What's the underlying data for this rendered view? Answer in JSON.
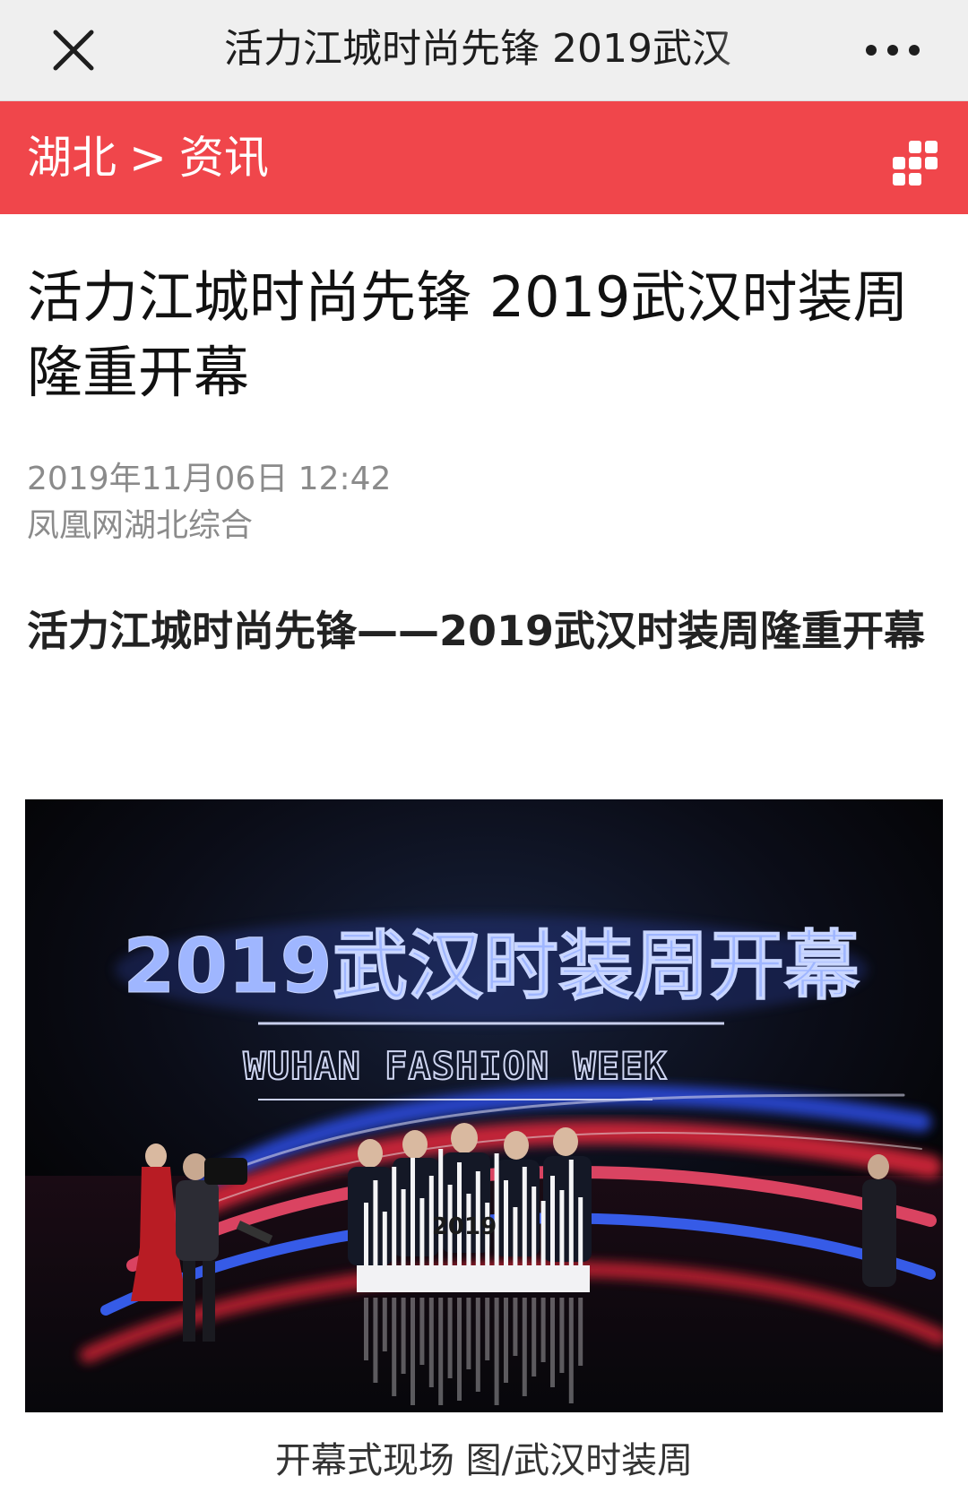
{
  "topbar": {
    "title": "活力江城时尚先锋 2019武汉",
    "close_icon": "close-icon",
    "more_icon": "more-icon"
  },
  "channel": {
    "crumbs": [
      "湖北",
      "资讯"
    ],
    "separator": ">",
    "menu_icon": "grid-menu-icon",
    "color": "#f0464b"
  },
  "article": {
    "title": "活力江城时尚先锋 2019武汉时装周隆重开幕",
    "date": "2019年11月06日 12:42",
    "source": "凤凰网湖北综合",
    "subtitle": "活力江城时尚先锋——2019武汉时装周隆重开幕"
  },
  "photo": {
    "headline": "2019武汉时装周开幕",
    "sub_headline": "WUHAN FASHION WEEK",
    "prop_text": "2019",
    "caption": "开幕式现场 图/武汉时装周"
  }
}
